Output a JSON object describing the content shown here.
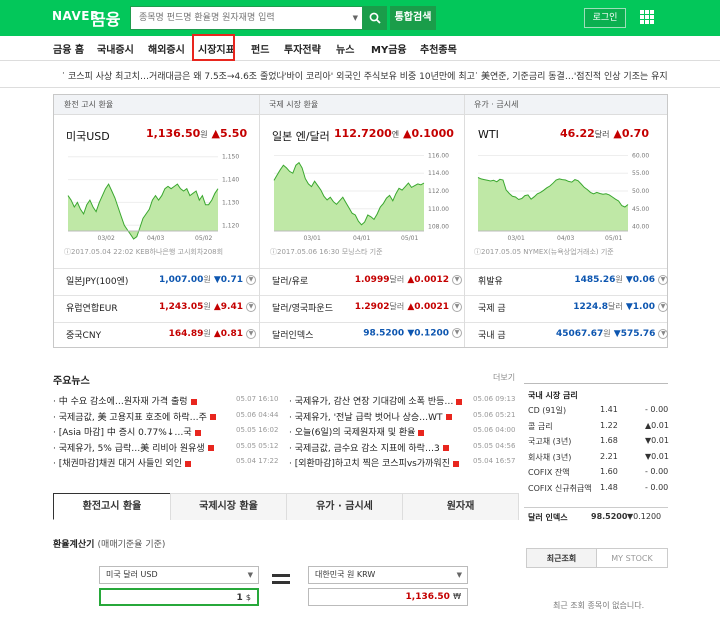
{
  "header": {
    "logo": "NAVER",
    "logo_sub": "금융",
    "search_placeholder": "종목명 펀드명 환율명 원자재명 입력",
    "search_btn": "통합검색",
    "login": "로그인"
  },
  "nav": [
    {
      "label": "금융 홈"
    },
    {
      "label": "국내증시"
    },
    {
      "label": "해외증시"
    },
    {
      "label": "시장지표",
      "active": true
    },
    {
      "label": "펀드"
    },
    {
      "label": "투자전략"
    },
    {
      "label": "뉴스"
    },
    {
      "label": "MY금융"
    },
    {
      "label": "추천종목"
    }
  ],
  "ticker": [
    "코스피 사상 최고치…거래대금은 왜 7.5조→4.6조 줄었나",
    "'바이 코리아' 외국인 주식보유 비중 10년만에 최고",
    "美연준, 기준금리 동결…'점진적 인상 기조는 유지"
  ],
  "panels": [
    {
      "head": "환전 고시 환율",
      "name": "미국USD",
      "value": "1,136.50",
      "unit": "원",
      "change": "▲5.50",
      "source": "2017.05.04 22:02 KEB하나은행 고시회차208회",
      "yticks": [
        "1,150",
        "1,140",
        "1,130",
        "1,120"
      ],
      "xticks": [
        "03/02",
        "04/03",
        "05/02"
      ],
      "series": [
        1133,
        1131,
        1128,
        1130,
        1127,
        1125,
        1129,
        1131,
        1128,
        1126,
        1130,
        1133,
        1136,
        1138,
        1135,
        1132,
        1128,
        1124,
        1120,
        1118,
        1116,
        1114,
        1115,
        1119,
        1123,
        1125,
        1127,
        1131,
        1133,
        1131,
        1133,
        1136,
        1137,
        1136,
        1137,
        1138,
        1136,
        1135,
        1136,
        1133,
        1134,
        1135,
        1131,
        1133,
        1129,
        1129,
        1131,
        1134,
        1136
      ]
    },
    {
      "head": "국제 시장 환율",
      "name": "일본 엔/달러",
      "value": "112.7200",
      "unit": "엔",
      "change": "▲0.1000",
      "source": "2017.05.06 16:30 모닝스타 기준",
      "yticks": [
        "116.00",
        "114.00",
        "112.00",
        "110.00",
        "108.00"
      ],
      "xticks": [
        "03/01",
        "04/01",
        "05/01"
      ],
      "series": [
        113.2,
        113.8,
        114.4,
        114.9,
        114.6,
        114.2,
        114.0,
        114.9,
        115.2,
        114.6,
        113.4,
        112.8,
        112.5,
        113.1,
        112.6,
        112.1,
        111.4,
        111.0,
        111.3,
        110.8,
        110.5,
        110.9,
        111.3,
        110.7,
        110.1,
        109.5,
        109.3,
        108.6,
        108.2,
        108.5,
        109.3,
        109.1,
        108.8,
        109.4,
        110.2,
        110.6,
        111.2,
        111.5,
        110.9,
        111.7,
        112.3,
        112.1,
        112.5,
        112.9,
        112.4,
        112.6,
        112.8,
        112.7,
        112.9
      ]
    },
    {
      "head": "유가 · 금시세",
      "name": "WTI",
      "value": "46.22",
      "unit": "달러",
      "change": "▲0.70",
      "source": "2017.05.05 NYMEX(뉴욕상업거래소) 기준",
      "yticks": [
        "60.00",
        "55.00",
        "50.00",
        "45.00",
        "40.00"
      ],
      "xticks": [
        "03/01",
        "04/03",
        "05/01"
      ],
      "series": [
        53.8,
        53.4,
        53.2,
        53.0,
        52.8,
        53.0,
        52.6,
        53.3,
        53.1,
        50.3,
        49.3,
        48.5,
        48.3,
        47.6,
        47.9,
        48.7,
        48.9,
        47.7,
        48.4,
        49.2,
        49.6,
        50.2,
        50.9,
        51.4,
        52.2,
        53.1,
        53.4,
        53.2,
        53.1,
        52.7,
        52.5,
        53.2,
        52.9,
        52.0,
        51.0,
        50.4,
        49.6,
        49.2,
        49.6,
        49.3,
        49.1,
        49.2,
        48.9,
        48.3,
        47.7,
        47.2,
        45.9,
        45.5,
        46.2
      ]
    }
  ],
  "rows": [
    [
      {
        "label": "일본JPY(100엔)",
        "value": "1,007.00",
        "unit": "원",
        "change": "▼0.71",
        "dir": "dn"
      },
      {
        "label": "달러/유로",
        "value": "1.0999",
        "unit": "달러",
        "change": "▲0.0012",
        "dir": "up"
      },
      {
        "label": "휘발유",
        "value": "1485.26",
        "unit": "원",
        "change": "▼0.06",
        "dir": "dn"
      }
    ],
    [
      {
        "label": "유럽연합EUR",
        "value": "1,243.05",
        "unit": "원",
        "change": "▲9.41",
        "dir": "up"
      },
      {
        "label": "달러/영국파운드",
        "value": "1.2902",
        "unit": "달러",
        "change": "▲0.0021",
        "dir": "up"
      },
      {
        "label": "국제 금",
        "value": "1224.8",
        "unit": "달러",
        "change": "▼1.00",
        "dir": "dn"
      }
    ],
    [
      {
        "label": "중국CNY",
        "value": "164.89",
        "unit": "원",
        "change": "▲0.81",
        "dir": "up"
      },
      {
        "label": "달러인덱스",
        "value": "98.5200",
        "unit": "",
        "change": "▼0.1200",
        "dir": "dn"
      },
      {
        "label": "국내 금",
        "value": "45067.67",
        "unit": "원",
        "change": "▼575.76",
        "dir": "dn"
      }
    ]
  ],
  "news": {
    "title": "주요뉴스",
    "more": "더보기",
    "left": [
      {
        "text": "中 수요 감소에…원자재 가격 출렁",
        "date": "05.07 16:10"
      },
      {
        "text": "국제금값, 美 고용지표 호조에 하락…주",
        "date": "05.06 04:44"
      },
      {
        "text": "[Asia 마감] 中 증시 0.77%↓…국",
        "date": "05.05 16:02"
      },
      {
        "text": "국제유가, 5% 급락…美 리비아 원유생",
        "date": "05.05 05:12"
      },
      {
        "text": "[채권마감]채권 대거 사들인 외인",
        "date": "05.04 17:22"
      }
    ],
    "right": [
      {
        "text": "국제유가, 감산 연장 기대감에 소폭 반등…",
        "date": "05.06 09:13"
      },
      {
        "text": "국제유가, '전날 급락 벗어나 상승…WT",
        "date": "05.06 05:21"
      },
      {
        "text": "오늘(6일)의 국제원자재 및 환율",
        "date": "05.06 04:00"
      },
      {
        "text": "국제금값, 금수요 감소 지표에 하락…3",
        "date": "05.05 04:56"
      },
      {
        "text": "[외환마감]하고치 찍은 코스피vs가까워진",
        "date": "05.04 16:57"
      }
    ]
  },
  "rates": {
    "title": "국내 시장 금리",
    "items": [
      {
        "name": "CD (91일)",
        "value": "1.41",
        "change": "- 0.00",
        "dir": "none"
      },
      {
        "name": "콜 금리",
        "value": "1.22",
        "change": "▲0.01",
        "dir": "up"
      },
      {
        "name": "국고채 (3년)",
        "value": "1.68",
        "change": "▼0.01",
        "dir": "dn"
      },
      {
        "name": "회사채 (3년)",
        "value": "2.21",
        "change": "▼0.01",
        "dir": "dn"
      },
      {
        "name": "COFIX 잔액",
        "value": "1.60",
        "change": "- 0.00",
        "dir": "none"
      },
      {
        "name": "COFIX 신규취급액",
        "value": "1.48",
        "change": "- 0.00",
        "dir": "none"
      }
    ],
    "dollar_index": {
      "name": "달러 인덱스",
      "value": "98.5200",
      "change": "▼0.1200"
    }
  },
  "tabs": [
    "환전고시 환율",
    "국제시장 환율",
    "유가 · 금시세",
    "원자재"
  ],
  "calc": {
    "title": "환율계산기",
    "sub": "(매매기준율 기준)",
    "from": "미국 달러 USD",
    "to": "대한민국 원 KRW",
    "from_amount": "1",
    "from_unit": "$",
    "to_amount": "1,136.50",
    "to_unit": "₩"
  },
  "recent": {
    "tab1": "최근조회",
    "tab2": "MY STOCK",
    "empty": "최근 조회 종목이 없습니다."
  },
  "colors": {
    "brand": "#03c75a",
    "up": "#c40000",
    "down": "#0d56b0",
    "chart_fill": "#bfe8a6",
    "chart_line": "#3aa72f"
  }
}
